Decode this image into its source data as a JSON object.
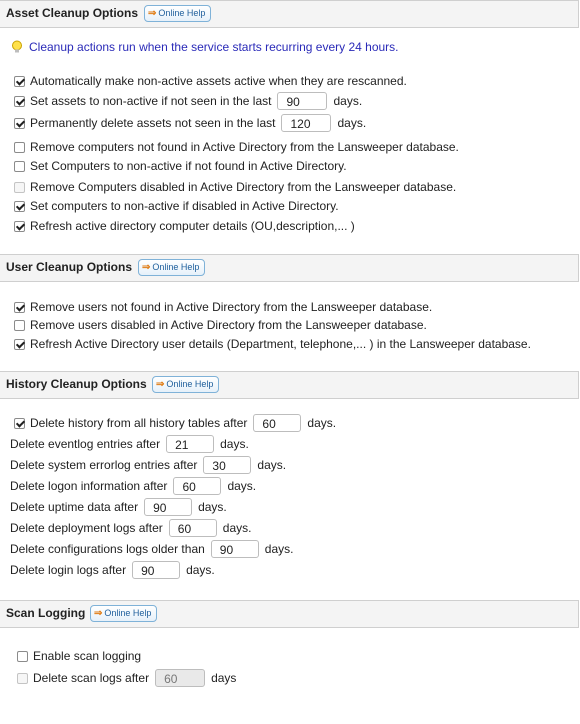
{
  "asset_cleanup": {
    "title": "Asset Cleanup Options",
    "help_label": "Online Help",
    "info": "Cleanup actions run when the service starts recurring every 24 hours.",
    "options": [
      {
        "label": "Automatically make non-active assets active when they are rescanned.",
        "checked": true
      },
      {
        "label_before": "Set assets to non-active if not seen in the last",
        "value": "90",
        "label_after": "days.",
        "checked": true
      },
      {
        "label_before": "Permanently delete assets not seen in the last",
        "value": "120",
        "label_after": "days.",
        "checked": true
      },
      {
        "label": "Remove computers not found in Active Directory from the Lansweeper database.",
        "checked": false
      },
      {
        "label": "Set Computers to non-active if not found in Active Directory.",
        "checked": false
      },
      {
        "label": "Remove Computers disabled in Active Directory from the Lansweeper database.",
        "checked": false,
        "disabled": true
      },
      {
        "label": "Set computers to non-active if disabled in Active Directory.",
        "checked": true
      },
      {
        "label": "Refresh active directory computer details (OU,description,... )",
        "checked": true
      }
    ]
  },
  "user_cleanup": {
    "title": "User Cleanup Options",
    "help_label": "Online Help",
    "options": [
      {
        "label": "Remove users not found in Active Directory from the Lansweeper database.",
        "checked": true
      },
      {
        "label": "Remove users disabled in Active Directory from the Lansweeper database.",
        "checked": false
      },
      {
        "label": "Refresh Active Directory user details (Department, telephone,... ) in the Lansweeper database.",
        "checked": true
      }
    ]
  },
  "history_cleanup": {
    "title": "History Cleanup Options",
    "help_label": "Online Help",
    "delete_all": {
      "label_before": "Delete history from all history tables after",
      "value": "60",
      "label_after": "days.",
      "checked": true
    },
    "rows": [
      {
        "label": "Delete eventlog entries after",
        "value": "21",
        "unit": "days."
      },
      {
        "label": "Delete system errorlog entries after",
        "value": "30",
        "unit": "days."
      },
      {
        "label": "Delete logon information after",
        "value": "60",
        "unit": "days."
      },
      {
        "label": "Delete uptime data after",
        "value": "90",
        "unit": "days."
      },
      {
        "label": "Delete deployment logs after",
        "value": "60",
        "unit": "days."
      },
      {
        "label": "Delete configurations logs older than",
        "value": "90",
        "unit": "days."
      },
      {
        "label": "Delete login logs after",
        "value": "90",
        "unit": "days."
      }
    ]
  },
  "scan_logging": {
    "title": "Scan Logging",
    "help_label": "Online Help",
    "enable": {
      "label": "Enable scan logging",
      "checked": false
    },
    "delete": {
      "label_before": "Delete scan logs after",
      "value": "60",
      "label_after": "days",
      "checked": false,
      "disabled": true
    }
  }
}
